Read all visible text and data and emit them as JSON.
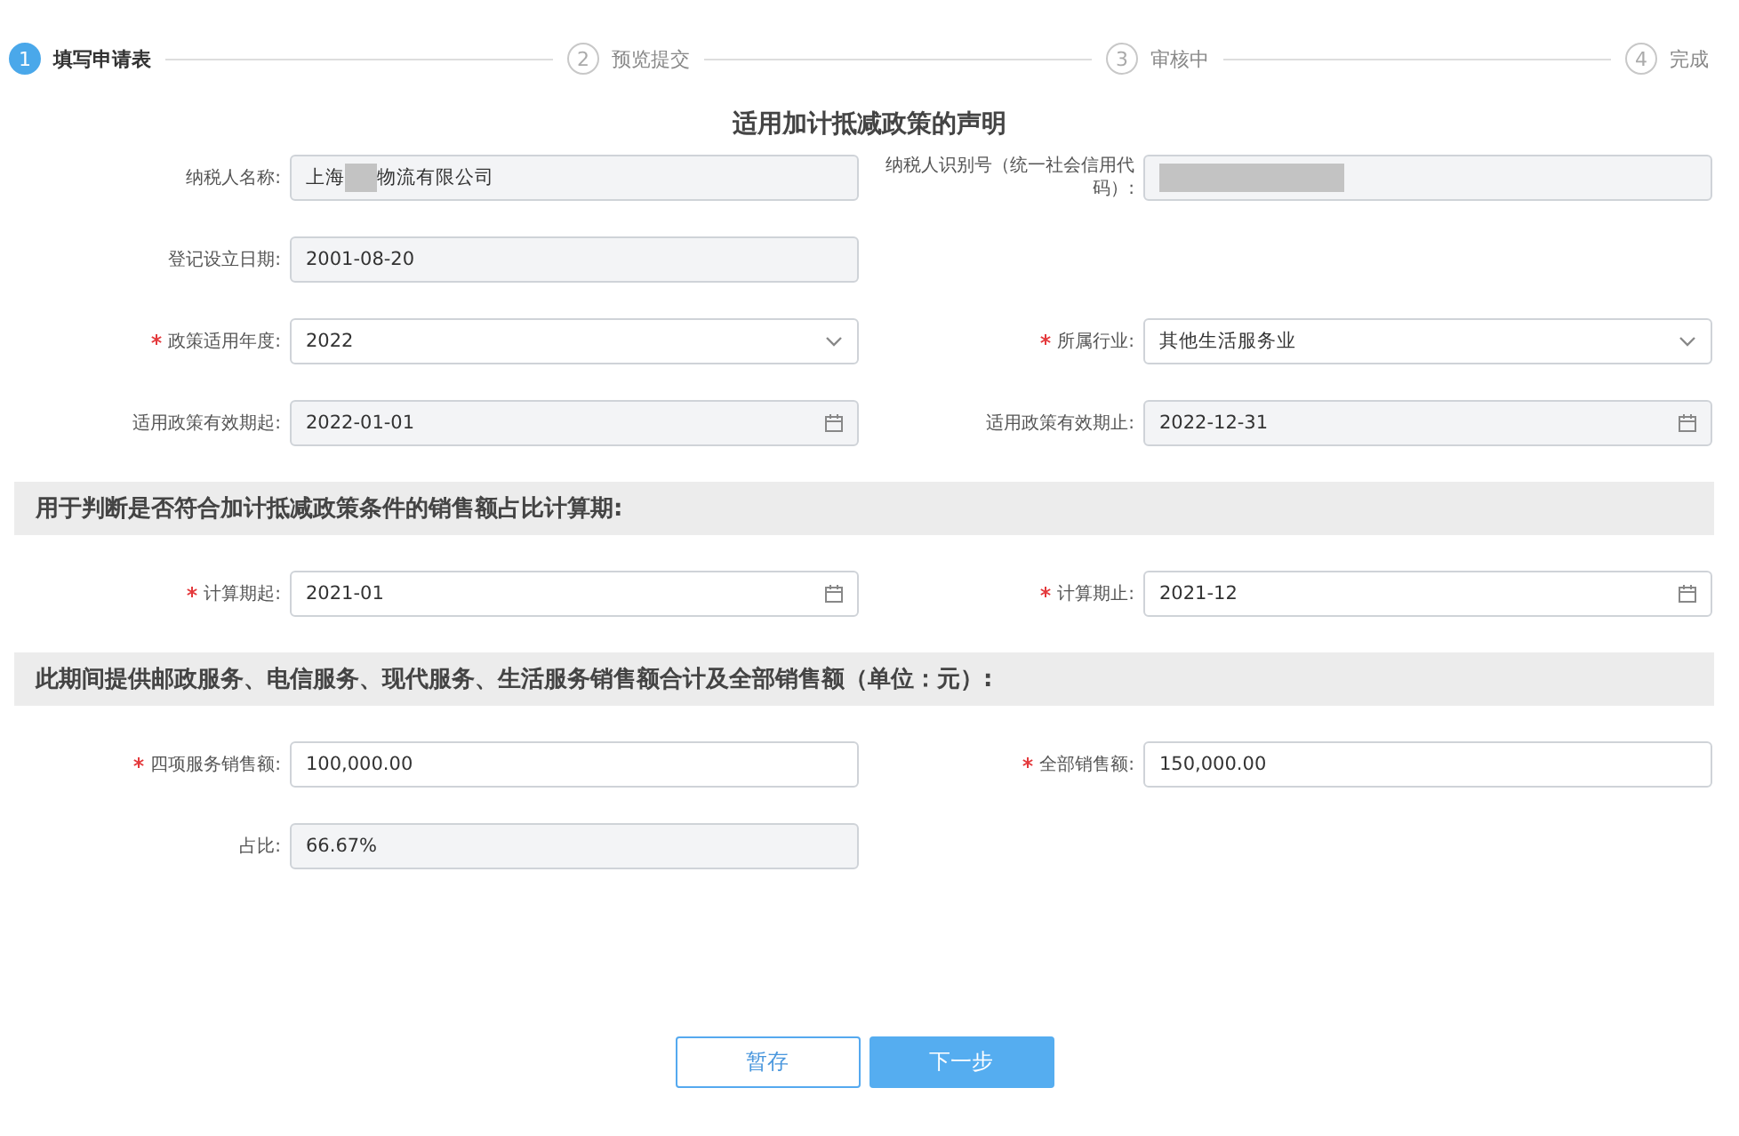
{
  "steps": [
    {
      "number": "1",
      "label": "填写申请表",
      "selected": true
    },
    {
      "number": "2",
      "label": "预览提交",
      "selected": false
    },
    {
      "number": "3",
      "label": "审核中",
      "selected": false
    },
    {
      "number": "4",
      "label": "完成",
      "selected": false
    }
  ],
  "title": "适用加计抵减政策的声明",
  "rows": [
    {
      "kind": "fields",
      "fields": [
        {
          "label": "纳税人名称:",
          "kind": "text",
          "required": false,
          "disabled": true,
          "value_parts": [
            {
              "kind": "text",
              "text": "上海"
            },
            {
              "kind": "redaction"
            },
            {
              "kind": "text",
              "text": "物流有限公司"
            }
          ]
        },
        {
          "label": "纳税人识别号（统一社会信用代码）:",
          "kind": "text",
          "required": false,
          "disabled": true,
          "value_parts": [
            {
              "kind": "redaction"
            }
          ]
        }
      ]
    },
    {
      "kind": "fields",
      "fields": [
        {
          "label": "登记设立日期:",
          "kind": "text",
          "required": false,
          "disabled": true,
          "value_parts": [
            {
              "kind": "text",
              "text": "2001-08-20"
            }
          ]
        }
      ]
    },
    {
      "kind": "fields",
      "fields": [
        {
          "label": "政策适用年度:",
          "kind": "select",
          "required": true,
          "disabled": false,
          "value_parts": [
            {
              "kind": "text",
              "text": "2022"
            }
          ]
        },
        {
          "label": "所属行业:",
          "kind": "select",
          "required": true,
          "disabled": false,
          "value_parts": [
            {
              "kind": "text",
              "text": "其他生活服务业"
            }
          ]
        }
      ]
    },
    {
      "kind": "fields",
      "fields": [
        {
          "label": "适用政策有效期起:",
          "kind": "date",
          "required": false,
          "disabled": true,
          "value_parts": [
            {
              "kind": "text",
              "text": "2022-01-01"
            }
          ]
        },
        {
          "label": "适用政策有效期止:",
          "kind": "date",
          "required": false,
          "disabled": true,
          "value_parts": [
            {
              "kind": "text",
              "text": "2022-12-31"
            }
          ]
        }
      ]
    },
    {
      "kind": "section",
      "title": "用于判断是否符合加计抵减政策条件的销售额占比计算期:"
    },
    {
      "kind": "fields",
      "fields": [
        {
          "label": "计算期起:",
          "kind": "date",
          "required": true,
          "disabled": false,
          "value_parts": [
            {
              "kind": "text",
              "text": "2021-01"
            }
          ]
        },
        {
          "label": "计算期止:",
          "kind": "date",
          "required": true,
          "disabled": false,
          "value_parts": [
            {
              "kind": "text",
              "text": "2021-12"
            }
          ]
        }
      ]
    },
    {
      "kind": "section",
      "title": "此期间提供邮政服务、电信服务、现代服务、生活服务销售额合计及全部销售额（单位：元）:"
    },
    {
      "kind": "fields",
      "fields": [
        {
          "label": "四项服务销售额:",
          "kind": "text",
          "required": true,
          "disabled": false,
          "value_parts": [
            {
              "kind": "text",
              "text": "100,000.00"
            }
          ]
        },
        {
          "label": "全部销售额:",
          "kind": "text",
          "required": true,
          "disabled": false,
          "value_parts": [
            {
              "kind": "text",
              "text": "150,000.00"
            }
          ]
        }
      ]
    },
    {
      "kind": "fields",
      "fields": [
        {
          "label": "占比:",
          "kind": "text",
          "required": false,
          "disabled": true,
          "value_parts": [
            {
              "kind": "text",
              "text": "66.67%"
            }
          ]
        }
      ]
    }
  ],
  "buttons": [
    {
      "label": "暂存",
      "kind": "secondary"
    },
    {
      "label": "下一步",
      "kind": "primary"
    }
  ]
}
